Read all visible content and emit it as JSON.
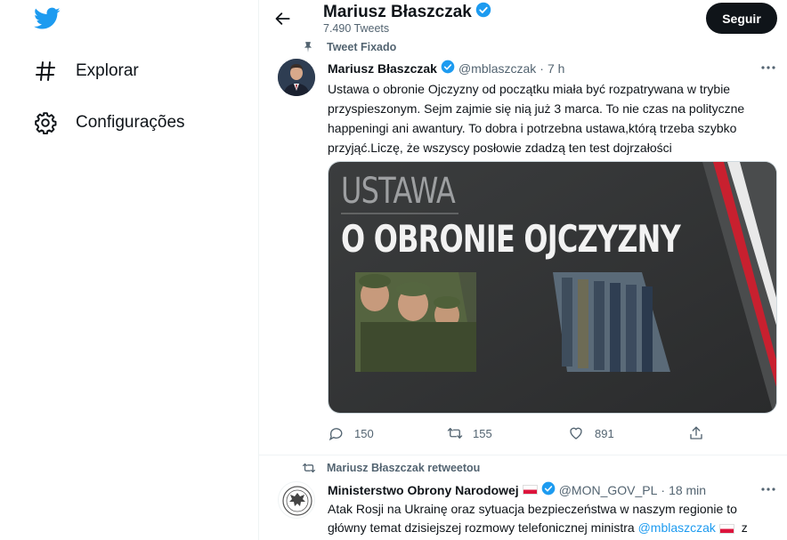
{
  "sidebar": {
    "logo_icon": "twitter-bird-icon",
    "items": [
      {
        "label": "Explorar",
        "icon": "hashtag-icon"
      },
      {
        "label": "Configurações",
        "icon": "gear-icon"
      }
    ]
  },
  "header": {
    "name": "Mariusz Błaszczak",
    "tweet_count": "7.490 Tweets",
    "follow_label": "Seguir"
  },
  "pinned_tweet": {
    "pinned_label": "Tweet Fixado",
    "author": "Mariusz Błaszczak",
    "handle": "@mblaszczak",
    "separator": "·",
    "time": "7 h",
    "text": "Ustawa o obronie Ojczyzny od początku miała być rozpatrywana w trybie przyspieszonym. Sejm zajmie się nią już 3 marca. To nie czas na polityczne happeningi ani awantury. To dobra i potrzebna ustawa,którą trzeba szybko przyjąć.Liczę, że wszyscy posłowie zdadzą ten test dojrzałości",
    "media": {
      "line1": "USTAWA",
      "line2": "O OBRONIE OJCZYZNY"
    },
    "actions": {
      "replies": "150",
      "retweets": "155",
      "likes": "891"
    }
  },
  "retweet": {
    "context": "Mariusz Błaszczak retweetou",
    "author": "Ministerstwo Obrony Narodowej",
    "handle": "@MON_GOV_PL",
    "separator": "·",
    "time": "18 min",
    "text_before": "Atak Rosji na Ukrainę oraz sytuacja bezpieczeństwa w naszym regionie to główny temat dzisiejszej rozmowy telefonicznej ministra ",
    "mention": "@mblaszczak",
    "text_after": " z"
  },
  "colors": {
    "accent": "#1d9bf0",
    "text": "#0f1419",
    "muted": "#536471"
  }
}
